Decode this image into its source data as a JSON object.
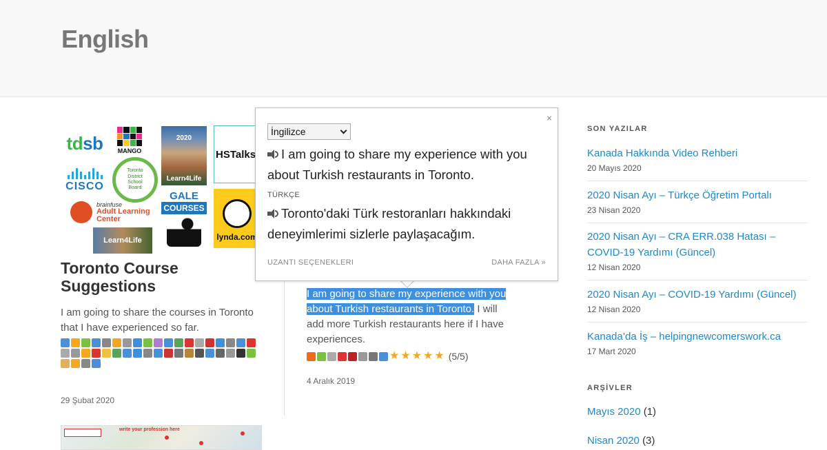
{
  "site": {
    "title": "English"
  },
  "posts": [
    {
      "title": "Toronto Course Suggestions",
      "excerpt": "I am going to share the courses in Toronto that I have experienced so far.",
      "date": "29 Şubat 2020",
      "logos": {
        "tdsb_left": "td",
        "tdsb_right": "sb",
        "mango": "MANGO",
        "learn4life_year": "2020",
        "learn4life": "Learn4Life",
        "hstalks": "HSTalks",
        "cisco": "CISCO",
        "tdsb_board": "Toronto District School Board",
        "gale": "GALE",
        "gale_courses": "COURSES",
        "lynda": "lynda.com",
        "brainfuse_small": "brainfuse",
        "brainfuse_big": "Adult Learning Center",
        "learn4life_small": "Learn4Life"
      }
    },
    {
      "excerpt_highlighted": "I am going to share my experience with you about Turkish restaurants in Toronto.",
      "excerpt_rest": " I will add more Turkish restaurants here if I have experiences.",
      "rating": "(5/5)",
      "date": "4 Aralık 2019"
    }
  ],
  "map_thumb": {
    "note": "write your profession here"
  },
  "translator": {
    "source_lang": "İngilizce",
    "source_text": "I am going to share my experience with you about Turkish restaurants in Toronto.",
    "target_lang_label": "TÜRKÇE",
    "target_text": "Toronto'daki Türk restoranları hakkındaki deneyimlerimi sizlerle paylaşacağım.",
    "close": "×",
    "options_link": "UZANTI SEÇENEKLERI",
    "more_link": "DAHA FAZLA »"
  },
  "sidebar": {
    "recent_heading": "SON YAZILAR",
    "recent": [
      {
        "title": "Kanada Hakkında Video Rehberi",
        "date": "20 Mayıs 2020"
      },
      {
        "title": "2020 Nisan Ayı – Türkçe Öğretim Portalı",
        "date": "23 Nisan 2020"
      },
      {
        "title": "2020 Nisan Ayı – CRA ERR.038 Hatası – COVID-19 Yardımı (Güncel)",
        "date": "12 Nisan 2020"
      },
      {
        "title": "2020 Nisan Ayı – COVID-19 Yardımı (Güncel)",
        "date": "12 Nisan 2020"
      },
      {
        "title": "Kanada’da İş – helpingnewcomerswork.ca",
        "date": "17 Mart 2020"
      }
    ],
    "archive_heading": "ARŞİVLER",
    "archives": [
      {
        "month": "Mayıs 2020",
        "count": "(1)"
      },
      {
        "month": "Nisan 2020",
        "count": "(3)"
      }
    ]
  },
  "colors": {
    "link": "#1f88c8",
    "highlight": "#3d8fe0",
    "star": "#f5a623"
  }
}
